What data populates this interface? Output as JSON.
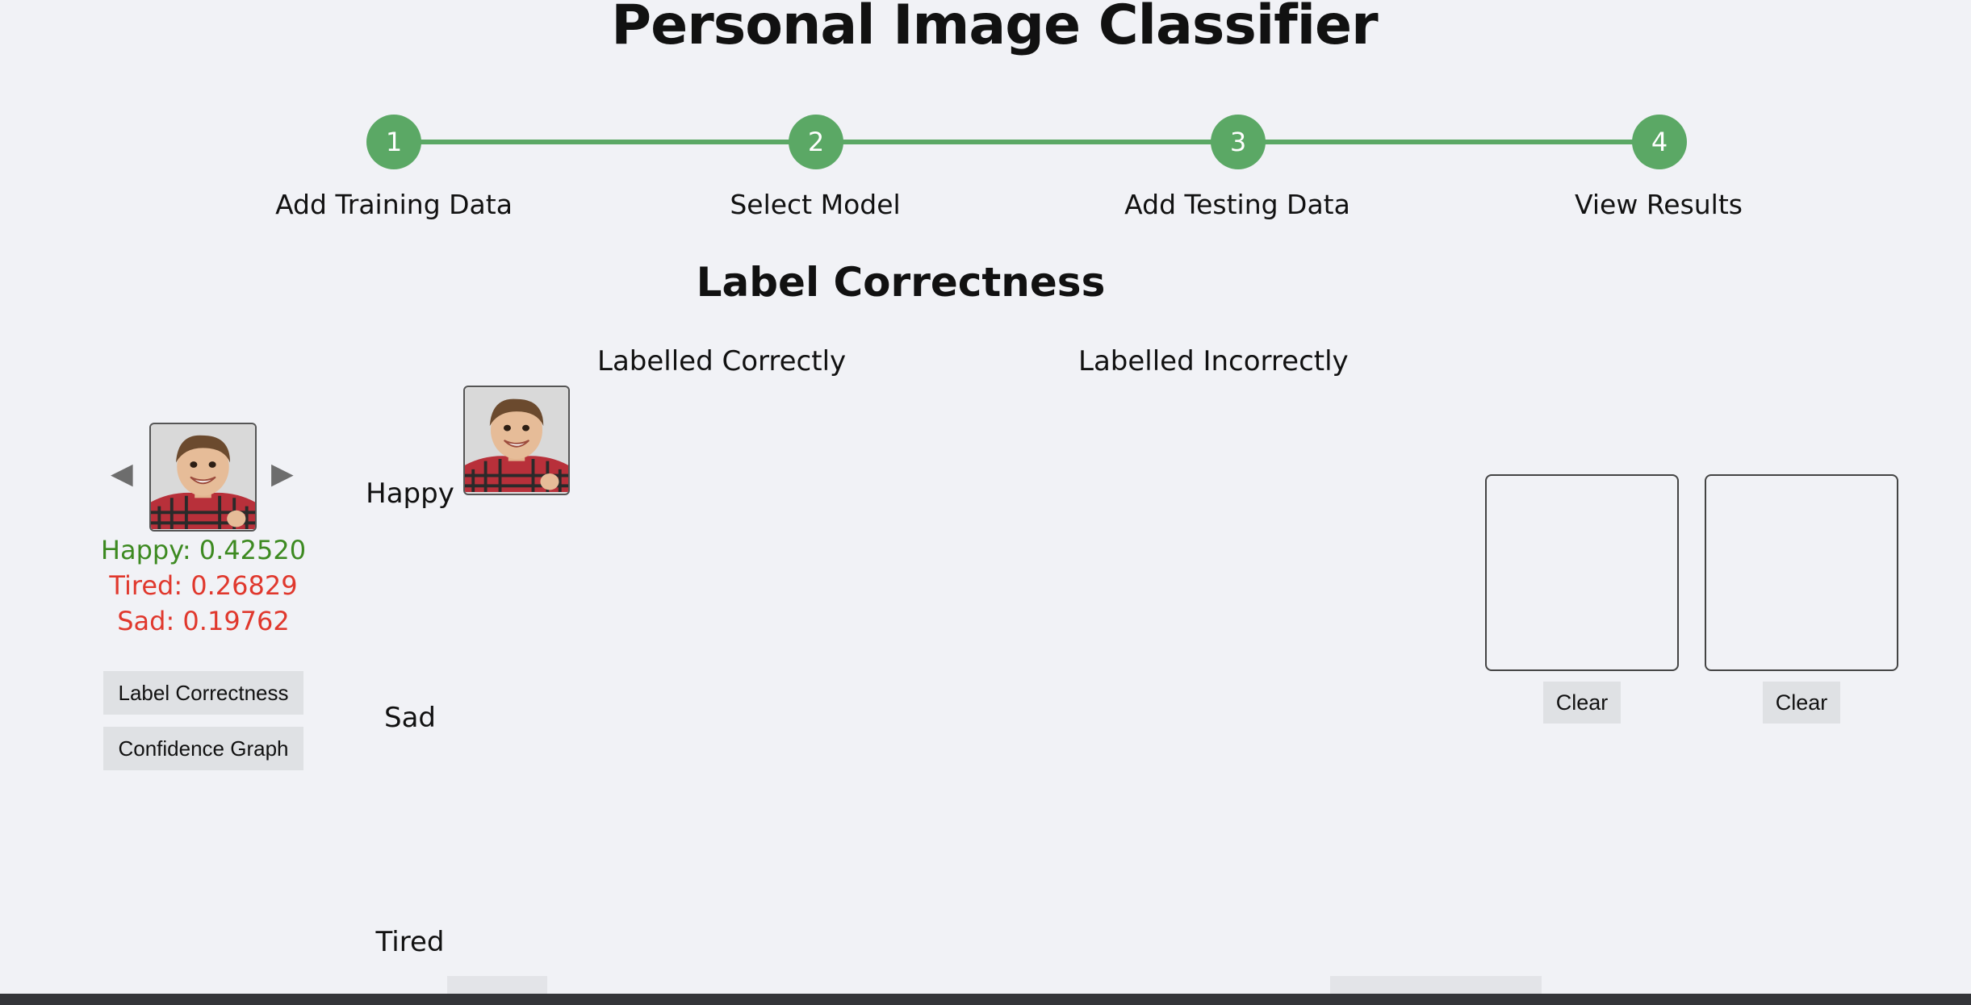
{
  "app": {
    "title": "Personal Image Classifier"
  },
  "stepper": {
    "steps": [
      {
        "number": "1",
        "label": "Add Training Data"
      },
      {
        "number": "2",
        "label": "Select Model"
      },
      {
        "number": "3",
        "label": "Add Testing Data"
      },
      {
        "number": "4",
        "label": "View Results"
      }
    ]
  },
  "results": {
    "title": "Label Correctness",
    "columns": {
      "correct": "Labelled Correctly",
      "incorrect": "Labelled Incorrectly"
    },
    "rows": [
      {
        "label": "Happy"
      },
      {
        "label": "Sad"
      },
      {
        "label": "Tired"
      }
    ]
  },
  "viewer": {
    "prev_icon": "◀",
    "next_icon": "▶",
    "confidences": [
      {
        "text": "Happy: 0.42520",
        "status": "correct"
      },
      {
        "text": "Tired: 0.26829",
        "status": "incorrect"
      },
      {
        "text": "Sad: 0.19762",
        "status": "incorrect"
      }
    ],
    "buttons": {
      "label_correctness": "Label Correctness",
      "confidence_graph": "Confidence Graph"
    }
  },
  "compare": {
    "clear_label": "Clear"
  },
  "colors": {
    "accent": "#5ba865",
    "correct": "#3d8a21",
    "incorrect": "#e0382d",
    "background": "#f1f2f6",
    "button": "#dfe1e4"
  },
  "icons": {
    "prev": "left-triangle-icon",
    "next": "right-triangle-icon"
  }
}
